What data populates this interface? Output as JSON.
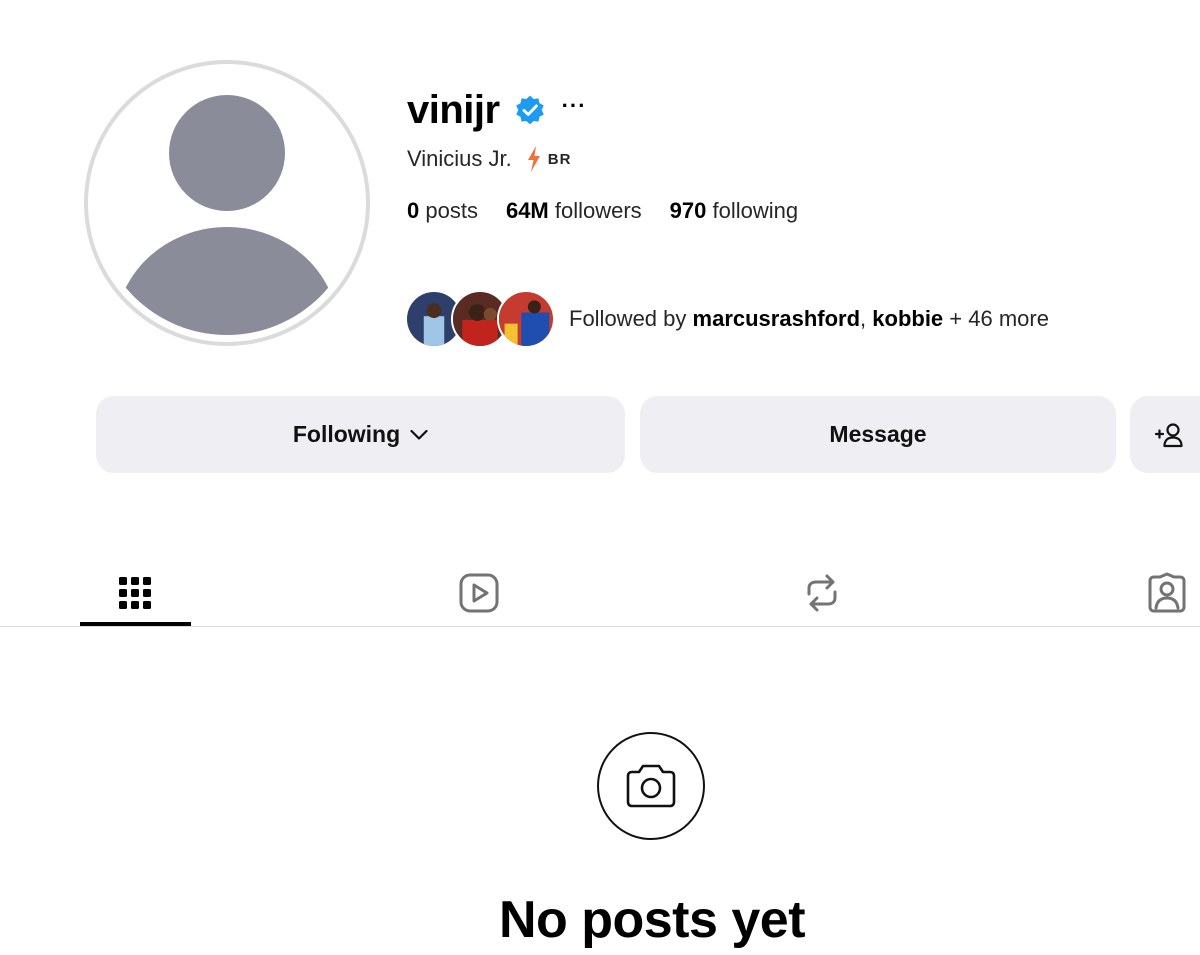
{
  "profile": {
    "username": "vinijr",
    "verified": true,
    "more_label": "···",
    "display_name": "Vinicius Jr.",
    "name_emoji": "lightning-bolt-icon",
    "country": "BR",
    "stats": {
      "posts_count": "0",
      "posts_label": " posts",
      "followers_count": "64M",
      "followers_label": " followers",
      "following_count": "970",
      "following_label": " following"
    },
    "followed_by": {
      "prefix": "Followed by ",
      "user1": "marcusrashford",
      "separator": ", ",
      "user2": "kobbie",
      "suffix": " + 46 more"
    }
  },
  "actions": {
    "following_label": "Following",
    "message_label": "Message",
    "add_user_icon": "add-user-icon"
  },
  "tabs": [
    {
      "name": "posts",
      "icon": "grid-icon",
      "active": true
    },
    {
      "name": "reels",
      "icon": "reels-icon",
      "active": false
    },
    {
      "name": "reposts",
      "icon": "repost-icon",
      "active": false
    },
    {
      "name": "tagged",
      "icon": "tagged-icon",
      "active": false
    }
  ],
  "empty_state": {
    "icon": "camera-icon",
    "title": "No posts yet"
  },
  "colors": {
    "verified_blue": "#1d9bf0",
    "button_bg": "#efeff3",
    "avatar_gray": "#8a8d99"
  }
}
